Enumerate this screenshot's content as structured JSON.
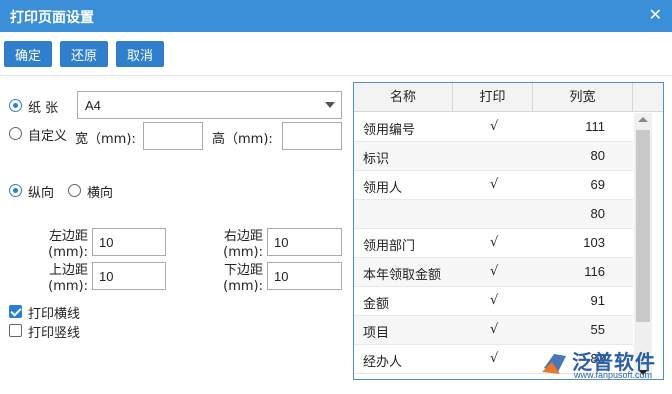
{
  "window": {
    "title": "打印页面设置",
    "close_glyph": "✕"
  },
  "toolbar": {
    "confirm": "确定",
    "restore": "还原",
    "cancel": "取消"
  },
  "paper": {
    "paper_label": "纸 张",
    "paper_value": "A4",
    "custom_label": "自定义",
    "width_label": "宽（mm):",
    "width_value": "",
    "height_label": "高（mm):",
    "height_value": "",
    "paper_selected": true
  },
  "orientation": {
    "portrait": "纵向",
    "landscape": "横向",
    "selected": "portrait"
  },
  "margins": {
    "left_label": "左边距\n(mm):",
    "left_value": "10",
    "right_label": "右边距\n(mm):",
    "right_value": "10",
    "top_label": "上边距\n(mm):",
    "top_value": "10",
    "bottom_label": "下边距\n(mm):",
    "bottom_value": "10"
  },
  "options": {
    "print_hlines": "打印横线",
    "print_hlines_checked": true,
    "print_vlines": "打印竖线",
    "print_vlines_checked": false
  },
  "grid": {
    "columns": [
      "名称",
      "打印",
      "列宽"
    ],
    "rows": [
      {
        "name": "领用编号",
        "print": "√",
        "width": "111"
      },
      {
        "name": "标识",
        "print": "",
        "width": "80"
      },
      {
        "name": "领用人",
        "print": "√",
        "width": "69"
      },
      {
        "name": "",
        "print": "",
        "width": "80"
      },
      {
        "name": "领用部门",
        "print": "√",
        "width": "103"
      },
      {
        "name": "本年领取金额",
        "print": "√",
        "width": "116"
      },
      {
        "name": "金额",
        "print": "√",
        "width": "91"
      },
      {
        "name": "项目",
        "print": "√",
        "width": "55"
      },
      {
        "name": "经办人",
        "print": "√",
        "width": "83"
      }
    ]
  },
  "watermark": {
    "brand": "泛普软件",
    "url": "www.fanpusoft.com",
    "color": "#2a5fa8"
  },
  "colors": {
    "titlebar": "#3a8fd8",
    "button": "#2f7fcc",
    "accent": "#2a7fd4"
  }
}
